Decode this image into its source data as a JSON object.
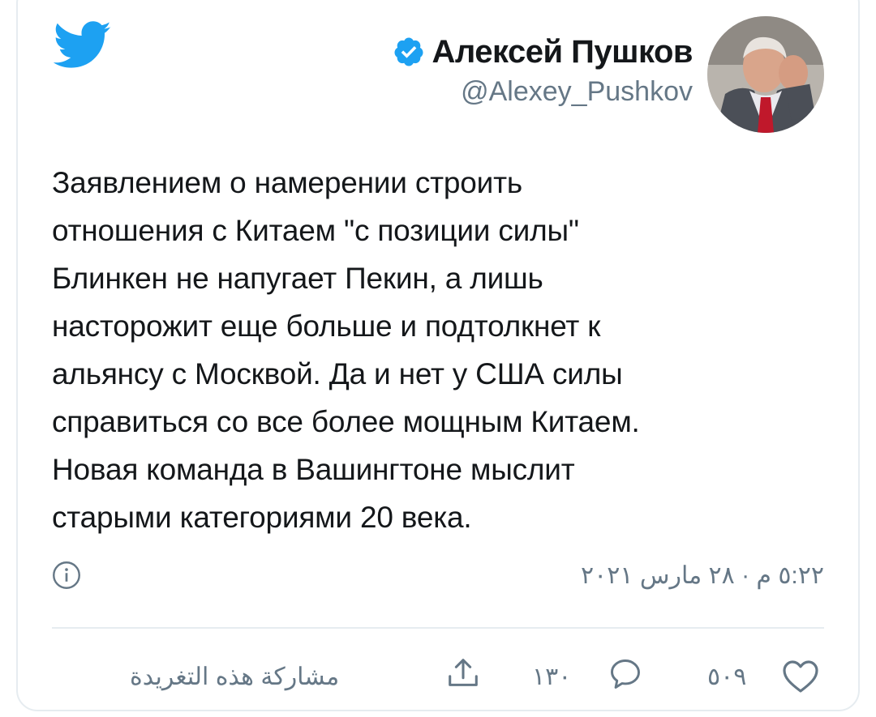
{
  "colors": {
    "twitter_blue": "#1da1f2",
    "verified_blue": "#1da1f2",
    "secondary_text": "#657786",
    "divider": "#e6ecf0"
  },
  "header": {
    "logo_icon": "twitter-bird-icon",
    "display_name": "Алексей Пушков",
    "verified_icon": "verified-badge-icon",
    "handle": "@Alexey_Pushkov",
    "avatar": "avatar"
  },
  "tweet": {
    "lines": [
      "Заявлением о намерении строить",
      "отношения с Китаем \"с позиции силы\"",
      "Блинкен не напугает Пекин, а лишь",
      "насторожит еще больше и подтолкнет к",
      "альянсу с Москвой. Да и нет у США силы",
      "справиться со все более мощным Китаем.",
      "Новая команда в Вашингтоне мыслит",
      "старыми категориями 20 века."
    ]
  },
  "meta": {
    "info_icon": "info-icon",
    "timestamp": "٥:٢٢ م · ٢٨ مارس ٢٠٢١"
  },
  "actions": {
    "like_icon": "heart-icon",
    "like_count": "٥٠٩",
    "reply_icon": "speech-bubble-icon",
    "reply_count": "١٣٠",
    "share_icon": "share-icon",
    "share_label": "مشاركة هذه التغريدة"
  }
}
